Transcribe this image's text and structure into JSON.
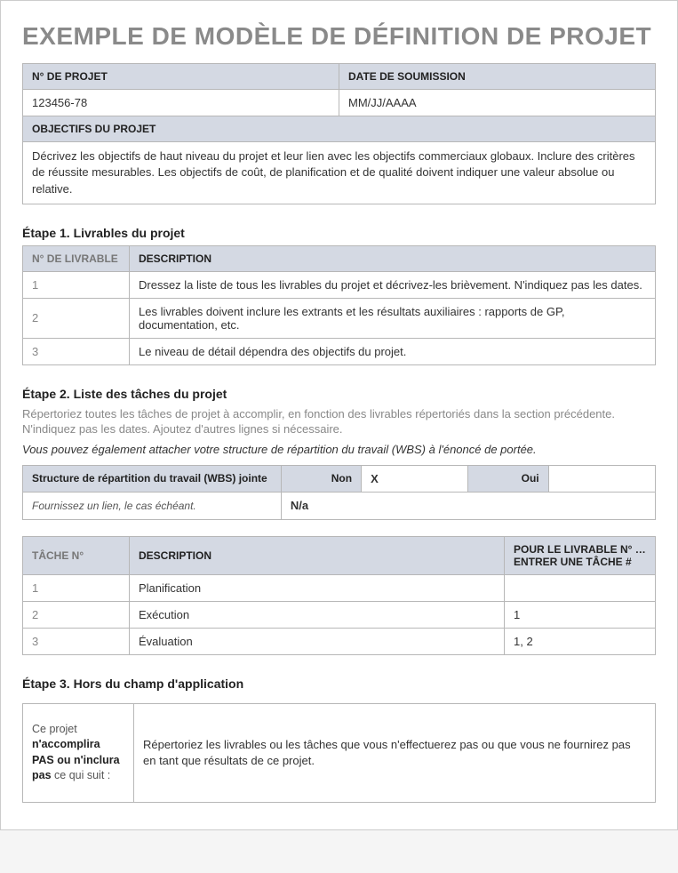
{
  "title": "EXEMPLE DE MODÈLE DE DÉFINITION DE  PROJET",
  "headerTable": {
    "projNoLabel": "N° DE PROJET",
    "projNoValue": "123456-78",
    "dateLabel": "DATE DE SOUMISSION",
    "dateValue": "MM/JJ/AAAA",
    "objectivesLabel": "OBJECTIFS DU PROJET",
    "objectivesText": "Décrivez les objectifs de haut niveau du projet et leur lien avec les objectifs commerciaux globaux.  Inclure des critères de réussite mesurables.  Les objectifs de coût, de planification et de qualité doivent indiquer une valeur absolue ou relative."
  },
  "step1": {
    "heading": "Étape 1. Livrables du projet",
    "colNo": "N° DE LIVRABLE",
    "colDesc": "DESCRIPTION",
    "rows": [
      {
        "n": "1",
        "d": "Dressez la liste de tous les livrables du projet et décrivez-les brièvement. N'indiquez pas les dates."
      },
      {
        "n": "2",
        "d": "Les livrables doivent inclure les extrants et les résultats auxiliaires : rapports de GP, documentation, etc."
      },
      {
        "n": "3",
        "d": "Le niveau de détail dépendra des objectifs du projet."
      }
    ]
  },
  "step2": {
    "heading": "Étape 2. Liste des tâches du projet",
    "sub": "Répertoriez toutes les tâches de projet à accomplir, en fonction des livrables répertoriés dans la section précédente. N'indiquez pas les dates. Ajoutez d'autres lignes si nécessaire.",
    "note": "Vous pouvez également attacher votre structure de répartition du travail (WBS) à l'énoncé de portée.",
    "wbsLabel": "Structure de répartition du travail (WBS) jointe",
    "nonLabel": "Non",
    "nonValue": "X",
    "ouiLabel": "Oui",
    "ouiValue": "",
    "linkLabel": "Fournissez un lien, le cas échéant.",
    "linkValue": "N/a",
    "colTask": "TÂCHE N°",
    "colDesc": "DESCRIPTION",
    "colDeliv": "POUR LE LIVRABLE N° … ENTRER UNE TÂCHE #",
    "rows": [
      {
        "n": "1",
        "d": "Planification",
        "de": ""
      },
      {
        "n": "2",
        "d": "Exécution",
        "de": "1"
      },
      {
        "n": "3",
        "d": "Évaluation",
        "de": "1, 2"
      }
    ]
  },
  "step3": {
    "heading": "Étape 3.  Hors du champ d'application",
    "labelPre": "Ce projet ",
    "labelBold": "n'accomplira PAS ou n'inclura pas",
    "labelPost": " ce qui suit :",
    "text": "Répertoriez les livrables ou les tâches que vous n'effectuerez pas ou que vous ne fournirez pas en tant que résultats de ce projet."
  }
}
